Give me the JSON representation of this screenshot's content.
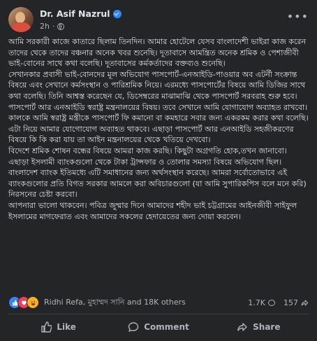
{
  "author": {
    "name": "Dr. Asif Nazrul",
    "time": "2h",
    "dot": "·"
  },
  "post": {
    "paragraphs": [
      "আমি সরকারী কাজে কাতারে ছিলাম তিনদিন। আমার হোটেলে যেসব বাংলাদেশী ভাইরা কাজ করেন তাদের থেকে তাদের বঞ্চনার অনেক খবর শুনেছি। দূতাবাসে আমন্ত্রিত অনেক শ্রমিক ও পেশাজীবী ভাই-বোনের সাথে কথা বলেছি। দূতাবাসের কর্মকর্তাদের বক্তব্যও শুনেছি।",
      "সেখানকার প্রবাসী ভাই-বোনদের মূল অভিযোগ পাসপোর্ট-এনআইডি-পাওয়ার অব এটর্নী সংক্রান্ত বিষয়ে এবং সেখানে কর্মসংস্থান ও পারিশ্রমিক নিয়ে। এরমধ্যে পাসপোর্টের বিষয়ে আমি ডিজির সাথে কথা বলেছি। তিনি আশ্বস্ত করেছেন যে, ডিসেম্বরের মাঝামাঝি থেকে পাসপোর্ট সরবরাহ শুরু হবে।",
      "পাসপোর্ট আর এনআইডি স্বরাষ্ট্র মন্ত্রনালয়ের বিষয়। তবে সেখানে আমি যোগাযোগ অব্যাহত রাখবো। কালকে আমি স্বরাষ্ট্র মন্ত্রীকে পাসপোর্ট ফি কমানো বা কমহারে সবার জন্য একরকম করার কথা বলেছি। এটা নিয়ে আমার যোগোযোগ অব্যাহত থাকবে। এছাড়া পাসপোর্ট আর এনআইডি সহজীকরণের বিষয়ে কি কি করা যায় তা আইন মন্ত্রনালয়ের থেকে খতিয়ে দেখবো।",
      "বিদেশে শ্রমিক শোষন বন্ধের বিষয়ে আমরা কাজ করছি। কিছুটা অগ্রগতি হোক,তখন জানাবো। এছাড়া ইসলামী ব্যাংকগুলো থেকে টাকা ট্রান্সফার ও তোলার সমস্যা বিষয়ে অভিযোগ ছিল।  বাংলাদেশ ব্যাংক ইতিমধ্যে এটি সমাধানের জন্য অর্থসংস্থান করেছে। আমরা সর্বোতোভাবে এই ব্যাংকগুলোর প্রতি বিগত সরকার আমলে করা অবিচারগুলো (যা আমি সুপারিকপিস বলে মনে করি) নিরসনের চেষ্টা করবো।",
      "আপনারা ভালো থাকবেন। পবিত্র জুম্মার দিনে আমাদের শহীদ ভাই চট্টগ্রামের আইনজীবী সাইফুল ইসলামের মাগফেরাত এবং আমাদের সকলের হেদায়েতের জন্য দোয়া করবেন।"
    ]
  },
  "reactions": {
    "names": "Ridhi Refa, মুহাম্মদ সানি and 18K others",
    "comments_count": "1.7K",
    "shares_count": "157",
    "icons": [
      "like-icon",
      "love-icon",
      "haha-icon"
    ],
    "colors": {
      "like": "#2d88ff",
      "love": "#f33e58",
      "haha": "#f7b125"
    }
  },
  "actions": {
    "like": "Like",
    "comment": "Comment",
    "share": "Share"
  }
}
